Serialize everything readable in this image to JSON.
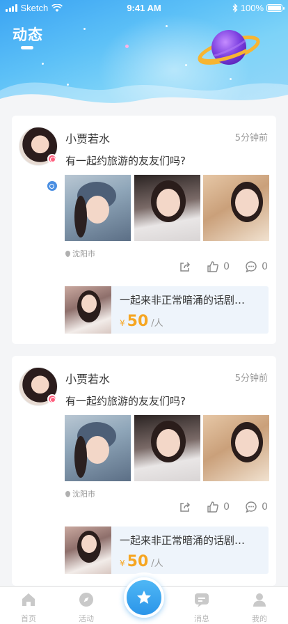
{
  "status_bar": {
    "carrier": "Sketch",
    "time": "9:41 AM",
    "battery": "100%"
  },
  "header": {
    "title": "动态"
  },
  "posts": [
    {
      "username": "小贾若水",
      "time_ago": "5分钟前",
      "text": "有一起约旅游的友友们吗?",
      "location": "沈阳市",
      "likes": "0",
      "comments": "0",
      "event": {
        "title": "一起来非正常暗涌的话剧…",
        "currency": "¥",
        "price": "50",
        "unit": "/人"
      }
    },
    {
      "username": "小贾若水",
      "time_ago": "5分钟前",
      "text": "有一起约旅游的友友们吗?",
      "location": "沈阳市",
      "likes": "0",
      "comments": "0",
      "event": {
        "title": "一起来非正常暗涌的话剧…",
        "currency": "¥",
        "price": "50",
        "unit": "/人"
      }
    }
  ],
  "tabbar": {
    "home": "首页",
    "activity": "活动",
    "messages": "消息",
    "mine": "我的"
  },
  "colors": {
    "accent": "#2b95e9",
    "price": "#f6a623",
    "gender_male": "#4a8fe2",
    "badge": "#ff5f7e"
  }
}
